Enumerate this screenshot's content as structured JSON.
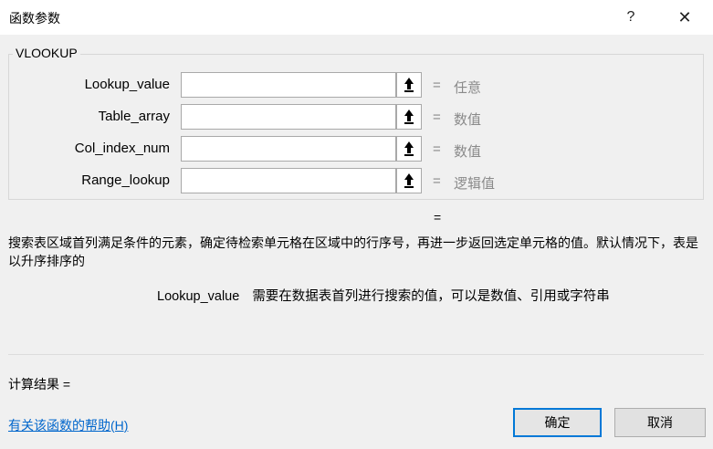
{
  "window": {
    "title": "函数参数",
    "help_glyph": "?",
    "close_glyph": "✕"
  },
  "function": {
    "name": "VLOOKUP",
    "args": [
      {
        "label": "Lookup_value",
        "value": "",
        "result": "任意"
      },
      {
        "label": "Table_array",
        "value": "",
        "result": "数值"
      },
      {
        "label": "Col_index_num",
        "value": "",
        "result": "数值"
      },
      {
        "label": "Range_lookup",
        "value": "",
        "result": "逻辑值"
      }
    ],
    "equals": "=",
    "result_equals": "=",
    "description": "搜索表区域首列满足条件的元素，确定待检索单元格在区域中的行序号，再进一步返回选定单元格的值。默认情况下，表是以升序排序的",
    "arg_help_name": "Lookup_value",
    "arg_help_text": "需要在数据表首列进行搜索的值，可以是数值、引用或字符串"
  },
  "footer": {
    "calc_result": "计算结果 =",
    "help_link": "有关该函数的帮助(H)",
    "ok_label": "确定",
    "cancel_label": "取消"
  }
}
